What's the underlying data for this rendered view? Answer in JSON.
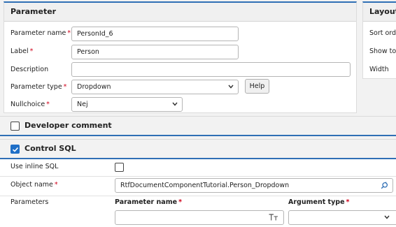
{
  "parameter_panel": {
    "title": "Parameter",
    "name_label": "Parameter name",
    "name_value": "PersonId_6",
    "label_label": "Label",
    "label_value": "Person",
    "description_label": "Description",
    "description_value": "",
    "type_label": "Parameter type",
    "type_value": "Dropdown",
    "help_label": "Help",
    "nullchoice_label": "Nullchoice",
    "nullchoice_value": "Nej"
  },
  "layout_panel": {
    "title": "Layout",
    "sort_order_label": "Sort orde",
    "show_to_label": "Show to t",
    "width_label": "Width"
  },
  "developer_comment": {
    "title": "Developer comment",
    "checked": false
  },
  "control_sql": {
    "title": "Control SQL",
    "checked": true,
    "inline_sql_label": "Use inline SQL",
    "inline_sql_checked": false,
    "object_name_label": "Object name",
    "object_name_value": "RtfDocumentComponentTutorial.Person_Dropdown",
    "parameters_label": "Parameters",
    "param_name_header": "Parameter name",
    "argument_type_header": "Argument type"
  },
  "colors": {
    "accent": "#2f6fb5",
    "required": "#d0021b",
    "checkbox": "#1f6fc7"
  }
}
